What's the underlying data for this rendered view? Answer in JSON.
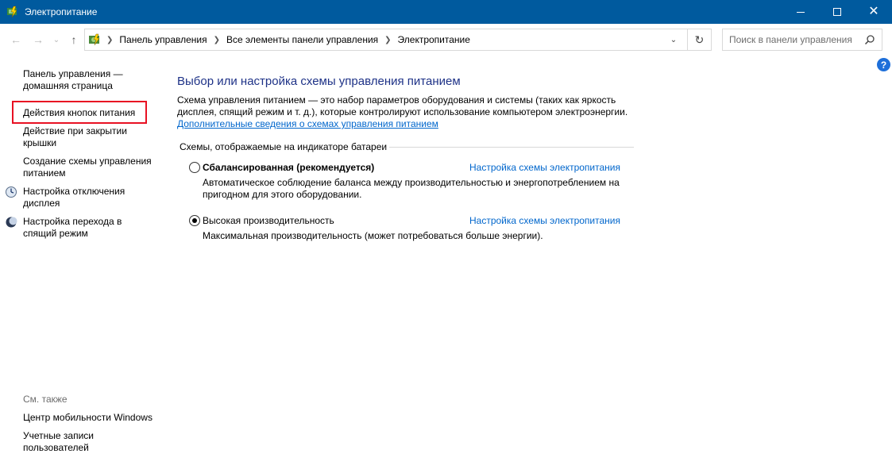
{
  "window": {
    "title": "Электропитание",
    "minimize": "minimize",
    "maximize": "maximize",
    "close": "✕"
  },
  "nav": {
    "back": "←",
    "forward": "→",
    "history": "⌄",
    "up": "↑",
    "breadcrumbs": [
      "Панель управления",
      "Все элементы панели управления",
      "Электропитание"
    ],
    "dropdown": "⌄",
    "refresh": "↻"
  },
  "search": {
    "placeholder": "Поиск в панели управления"
  },
  "help": "?",
  "sidebar": {
    "items": [
      {
        "label": "Панель управления —\nдомашняя страница"
      },
      {
        "label": "Действия кнопок питания"
      },
      {
        "label": "Действие при закрытии\nкрышки"
      },
      {
        "label": "Создание схемы управления\nпитанием"
      },
      {
        "label": "Настройка отключения\nдисплея"
      },
      {
        "label": "Настройка перехода в\nспящий режим"
      }
    ],
    "see_also_label": "См. также",
    "see_also": [
      {
        "label": "Центр мобильности Windows"
      },
      {
        "label": "Учетные записи\nпользователей"
      }
    ]
  },
  "main": {
    "heading": "Выбор или настройка схемы управления питанием",
    "description": "Схема управления питанием — это набор параметров оборудования и системы (таких как яркость дисплея, спящий режим и т. д.), которые контролируют использование компьютером электроэнергии.",
    "more_info_link": "Дополнительные сведения о схемах управления питанием",
    "group_label": "Схемы, отображаемые на индикаторе батареи",
    "plans": [
      {
        "name": "Сбалансированная (рекомендуется)",
        "settings_link": "Настройка схемы электропитания",
        "description": "Автоматическое соблюдение баланса между производительностью и энергопотреблением на пригодном для этого оборудовании.",
        "selected": false
      },
      {
        "name": "Высокая производительность",
        "settings_link": "Настройка схемы электропитания",
        "description": "Максимальная производительность (может потребоваться больше энергии).",
        "selected": true
      }
    ]
  },
  "colors": {
    "titlebar": "#005a9e",
    "heading": "#1e3287",
    "link": "#0066cc",
    "highlight": "#e81123"
  }
}
